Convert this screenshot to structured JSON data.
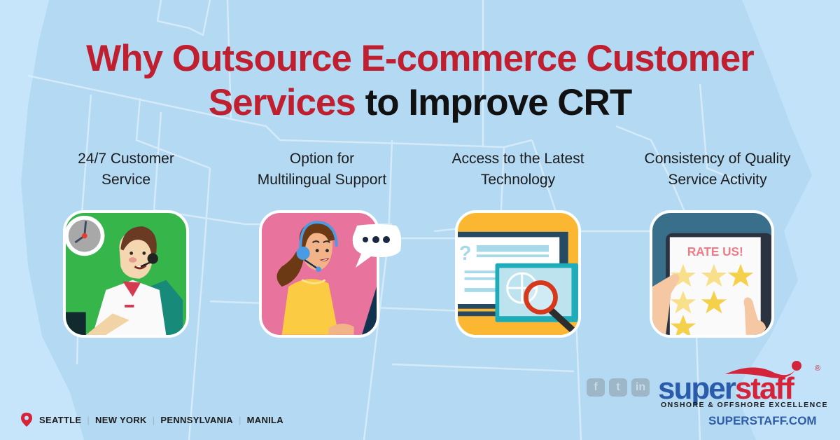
{
  "title": {
    "red_part_1": "Why Outsource E-commerce Customer",
    "red_part_2": "Services",
    "black_part": " to Improve CRT"
  },
  "features": [
    {
      "line1": "24/7 Customer",
      "line2": "Service",
      "icon": "support-agent-with-clock-icon",
      "card_color": "#36b54a"
    },
    {
      "line1": "Option for",
      "line2": "Multilingual Support",
      "icon": "agent-with-speech-bubble-icon",
      "card_color": "#e8739c"
    },
    {
      "line1": "Access to the Latest",
      "line2": "Technology",
      "icon": "tablet-with-magnifier-icon",
      "card_color": "#fbb731"
    },
    {
      "line1": "Consistency of Quality",
      "line2": "Service Activity",
      "icon": "rate-us-tablet-icon",
      "card_color": "#3a6f8c"
    }
  ],
  "rate_us_text": "RATE US!",
  "locations": [
    "SEATTLE",
    "NEW YORK",
    "PENNSYLVANIA",
    "MANILA"
  ],
  "social": [
    {
      "name": "facebook",
      "glyph": "f"
    },
    {
      "name": "twitter",
      "glyph": "t"
    },
    {
      "name": "linkedin",
      "glyph": "in"
    }
  ],
  "brand": {
    "logo_blue": "super",
    "logo_red": "staff",
    "registered": "®",
    "tagline": "ONSHORE & OFFSHORE EXCELLENCE",
    "url": "SUPERSTAFF.COM"
  },
  "colors": {
    "title_red": "#c01f30",
    "brand_blue": "#2a5cab",
    "brand_red": "#d3243a",
    "background": "#c5e4f9"
  }
}
